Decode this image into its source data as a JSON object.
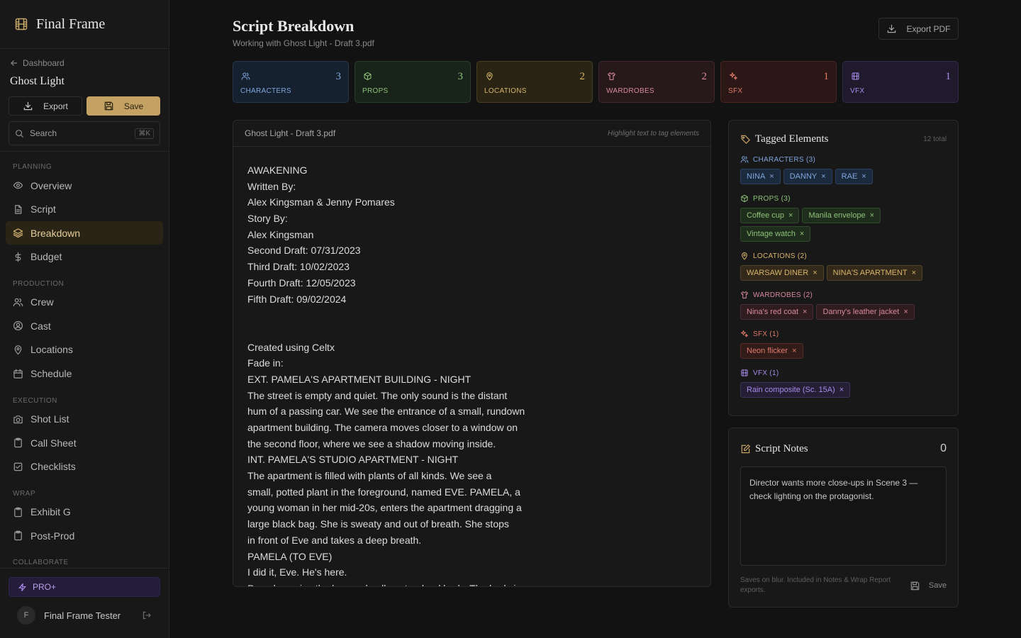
{
  "brand": {
    "name": "Final Frame"
  },
  "project": {
    "back_label": "Dashboard",
    "name": "Ghost Light",
    "export_label": "Export",
    "save_label": "Save",
    "search_label": "Search",
    "search_kbd": "⌘K"
  },
  "nav": {
    "sections": [
      {
        "label": "PLANNING",
        "items": [
          {
            "label": "Overview",
            "icon": "eye-icon"
          },
          {
            "label": "Script",
            "icon": "document-icon"
          },
          {
            "label": "Breakdown",
            "icon": "layers-icon",
            "active": true
          },
          {
            "label": "Budget",
            "icon": "dollar-icon"
          }
        ]
      },
      {
        "label": "PRODUCTION",
        "items": [
          {
            "label": "Crew",
            "icon": "users-icon"
          },
          {
            "label": "Cast",
            "icon": "user-circle-icon"
          },
          {
            "label": "Locations",
            "icon": "map-pin-icon"
          },
          {
            "label": "Schedule",
            "icon": "calendar-icon"
          }
        ]
      },
      {
        "label": "EXECUTION",
        "items": [
          {
            "label": "Shot List",
            "icon": "camera-icon"
          },
          {
            "label": "Call Sheet",
            "icon": "clipboard-icon"
          },
          {
            "label": "Checklists",
            "icon": "checklist-icon"
          }
        ]
      },
      {
        "label": "WRAP",
        "items": [
          {
            "label": "Exhibit G",
            "icon": "clipboard-icon"
          },
          {
            "label": "Post-Prod",
            "icon": "clipboard-icon"
          }
        ]
      },
      {
        "label": "COLLABORATE",
        "items": []
      }
    ]
  },
  "footer": {
    "pro_label": "PRO+",
    "avatar_initial": "F",
    "user_name": "Final Frame Tester"
  },
  "header": {
    "title": "Script Breakdown",
    "subtitle": "Working with Ghost Light - Draft 3.pdf",
    "export_pdf_label": "Export PDF"
  },
  "stats": [
    {
      "label": "CHARACTERS",
      "count": "3",
      "color": "#7fa6dc",
      "bg": "#162130",
      "border": "#25364d",
      "icon": "users-icon"
    },
    {
      "label": "PROPS",
      "count": "3",
      "color": "#8fc27a",
      "bg": "#18241a",
      "border": "#2a3d2a",
      "icon": "box-icon"
    },
    {
      "label": "LOCATIONS",
      "count": "2",
      "color": "#d8b46a",
      "bg": "#2a2415",
      "border": "#4a3f22",
      "icon": "map-pin-icon"
    },
    {
      "label": "WARDROBES",
      "count": "2",
      "color": "#d88a9a",
      "bg": "#26181b",
      "border": "#44272d",
      "icon": "shirt-icon"
    },
    {
      "label": "SFX",
      "count": "1",
      "color": "#e07a6a",
      "bg": "#2a1716",
      "border": "#4a2622",
      "icon": "sparkle-icon"
    },
    {
      "label": "VFX",
      "count": "1",
      "color": "#a78bea",
      "bg": "#1f1a2c",
      "border": "#342a4a",
      "icon": "film-icon"
    }
  ],
  "script": {
    "file_name": "Ghost Light - Draft 3.pdf",
    "hint": "Highlight text to tag elements",
    "lines": [
      "AWAKENING",
      "Written By:",
      "Alex Kingsman & Jenny Pomares",
      "Story By:",
      "Alex Kingsman",
      "Second Draft: 07/31/2023",
      "Third Draft: 10/02/2023",
      "Fourth Draft: 12/05/2023",
      "Fifth Draft: 09/02/2024",
      "",
      "",
      "Created using Celtx",
      "Fade in:",
      "EXT. PAMELA'S APARTMENT BUILDING - NIGHT",
      "The street is empty and quiet. The only sound is the distant",
      "hum of a passing car. We see the entrance of a small, rundown",
      "apartment building. The camera moves closer to a window on",
      "the second floor, where we see a shadow moving inside.",
      "INT. PAMELA'S STUDIO APARTMENT - NIGHT",
      "The apartment is filled with plants of all kinds. We see a",
      "small, potted plant in the foreground, named EVE. PAMELA, a",
      "young woman in her mid-20s, enters the apartment dragging a",
      "large black bag. She is sweaty and out of breath. She stops",
      "in front of Eve and takes a deep breath.",
      "PAMELA (TO EVE)",
      "I did it, Eve. He's here.",
      "Pamela unzips the bag and pulls out a dead body. The body is"
    ]
  },
  "tagged": {
    "title": "Tagged Elements",
    "total": "12 total",
    "groups": [
      {
        "label": "CHARACTERS (3)",
        "color": "#7fa6dc",
        "chip_bg": "#1c2a3e",
        "chip_border": "#2c4160",
        "icon": "users-icon",
        "items": [
          "NINA",
          "DANNY",
          "RAE"
        ]
      },
      {
        "label": "PROPS (3)",
        "color": "#8fc27a",
        "chip_bg": "#1e2d1c",
        "chip_border": "#304a2c",
        "icon": "box-icon",
        "items": [
          "Coffee cup",
          "Manila envelope",
          "Vintage watch"
        ]
      },
      {
        "label": "LOCATIONS (2)",
        "color": "#d8b46a",
        "chip_bg": "#33291a",
        "chip_border": "#54452a",
        "icon": "map-pin-icon",
        "items": [
          "WARSAW DINER",
          "NINA'S APARTMENT"
        ]
      },
      {
        "label": "WARDROBES (2)",
        "color": "#d88a9a",
        "chip_bg": "#2e1c20",
        "chip_border": "#4c2c33",
        "icon": "shirt-icon",
        "items": [
          "Nina's red coat",
          "Danny's leather jacket"
        ]
      },
      {
        "label": "SFX (1)",
        "color": "#e07a6a",
        "chip_bg": "#321c1a",
        "chip_border": "#532d28",
        "icon": "sparkle-icon",
        "items": [
          "Neon flicker"
        ]
      },
      {
        "label": "VFX (1)",
        "color": "#a78bea",
        "chip_bg": "#251f36",
        "chip_border": "#3d3258",
        "icon": "film-icon",
        "items": [
          "Rain composite (Sc. 15A)"
        ]
      }
    ]
  },
  "notes": {
    "title": "Script Notes",
    "count": "0",
    "text": "Director wants more close-ups in Scene 3 — check lighting on the protagonist.",
    "help": "Saves on blur. Included in Notes & Wrap Report exports.",
    "save_label": "Save"
  }
}
